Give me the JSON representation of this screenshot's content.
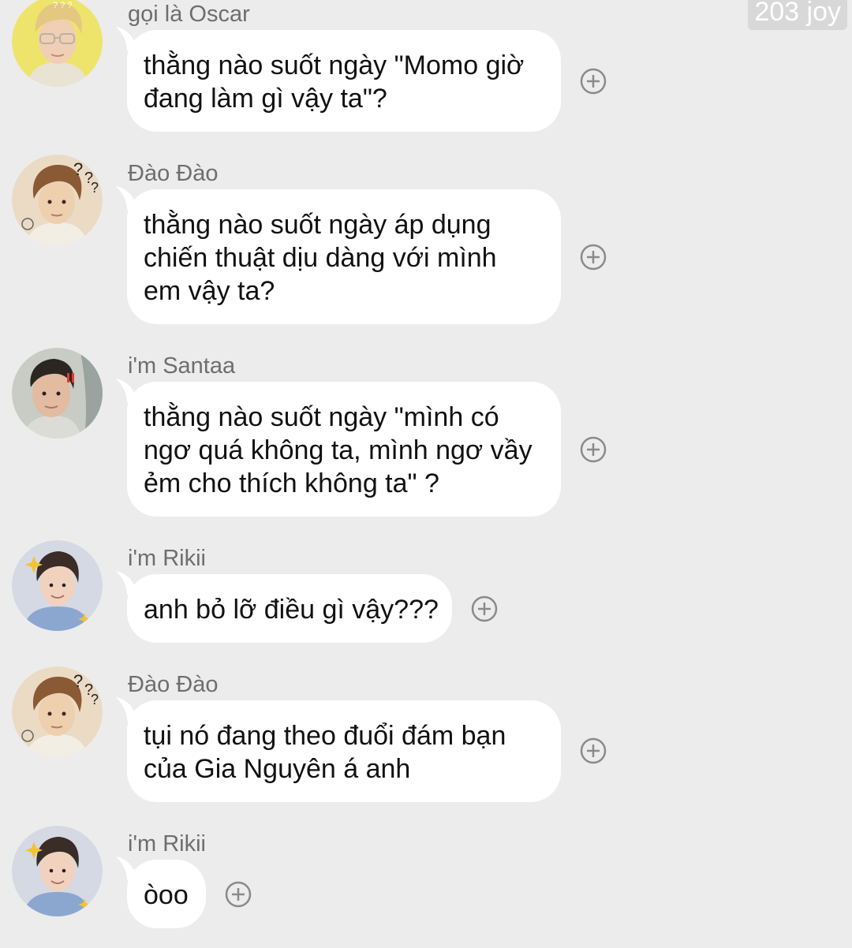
{
  "watermark": "203 joy",
  "messages": [
    {
      "sender": "gọi là Oscar",
      "avatar_icon": "user-avatar-oscar",
      "avatar_badge": "? ? ?",
      "lines": [
        "thằng nào suốt ngày \"Momo giờ",
        "đang làm gì vậy ta\"?"
      ]
    },
    {
      "sender": "Đào Đào",
      "avatar_icon": "user-avatar-dao",
      "lines": [
        "thằng nào suốt ngày áp dụng",
        "chiến thuật dịu dàng với mình",
        "em vậy ta?"
      ]
    },
    {
      "sender": "i'm Santaa",
      "avatar_icon": "user-avatar-santaa",
      "lines": [
        "thằng nào suốt ngày \"mình có",
        "ngơ quá không ta, mình ngơ vầy",
        "ẻm cho thích không ta\" ?"
      ]
    },
    {
      "sender": "i'm Rikii",
      "avatar_icon": "user-avatar-rikii",
      "lines": [
        "anh bỏ lỡ điều gì vậy???"
      ]
    },
    {
      "sender": "Đào Đào",
      "avatar_icon": "user-avatar-dao",
      "lines": [
        "tụi nó đang theo đuổi đám bạn",
        "của Gia Nguyên á anh"
      ]
    },
    {
      "sender": "i'm Rikii",
      "avatar_icon": "user-avatar-rikii",
      "lines": [
        "òoo"
      ]
    }
  ],
  "reaction_icon": "add-reaction-icon",
  "colors": {
    "background": "#ececec",
    "bubble": "#ffffff",
    "name": "#6e6e6e",
    "text": "#111111",
    "icon": "#8a8a8a"
  }
}
